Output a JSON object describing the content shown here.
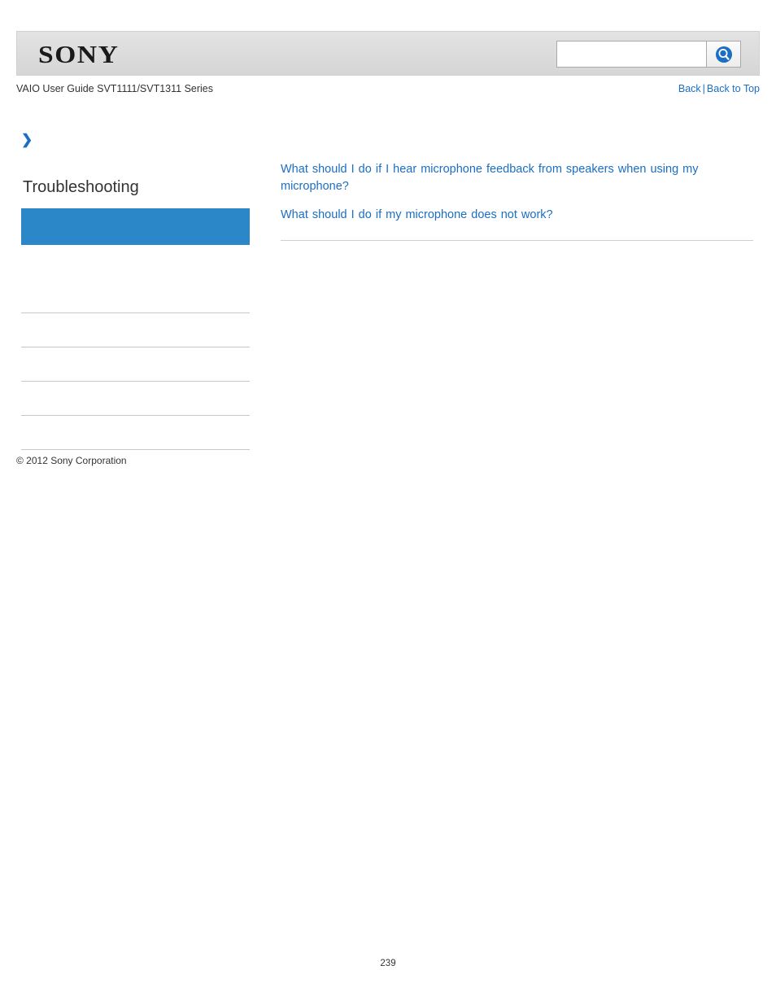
{
  "header": {
    "logo_text": "SONY",
    "search": {
      "value": "",
      "placeholder": "",
      "button_icon": "search-icon"
    }
  },
  "titlebar": {
    "guide_title": "VAIO User Guide SVT1111/SVT1311 Series",
    "back_label": "Back",
    "separator": "|",
    "back_to_top_label": "Back to Top"
  },
  "sidebar": {
    "arrow_icon": "chevron-right-icon",
    "heading": "Troubleshooting",
    "items": [
      {
        "label": "",
        "selected": true
      },
      {
        "label": "",
        "selected": false
      },
      {
        "label": "",
        "selected": false
      },
      {
        "label": "",
        "selected": false
      },
      {
        "label": "",
        "selected": false
      },
      {
        "label": "",
        "selected": false
      }
    ]
  },
  "content": {
    "links": [
      "What should I do if I hear microphone feedback from speakers when using my microphone?",
      "What should I do if my microphone does not work?"
    ]
  },
  "footer": {
    "copyright": "© 2012 Sony Corporation",
    "page_number": "239"
  },
  "colors": {
    "accent_blue": "#1b6ec2",
    "selected_nav": "#2b87c8",
    "header_gray": "#dcdcdc"
  }
}
